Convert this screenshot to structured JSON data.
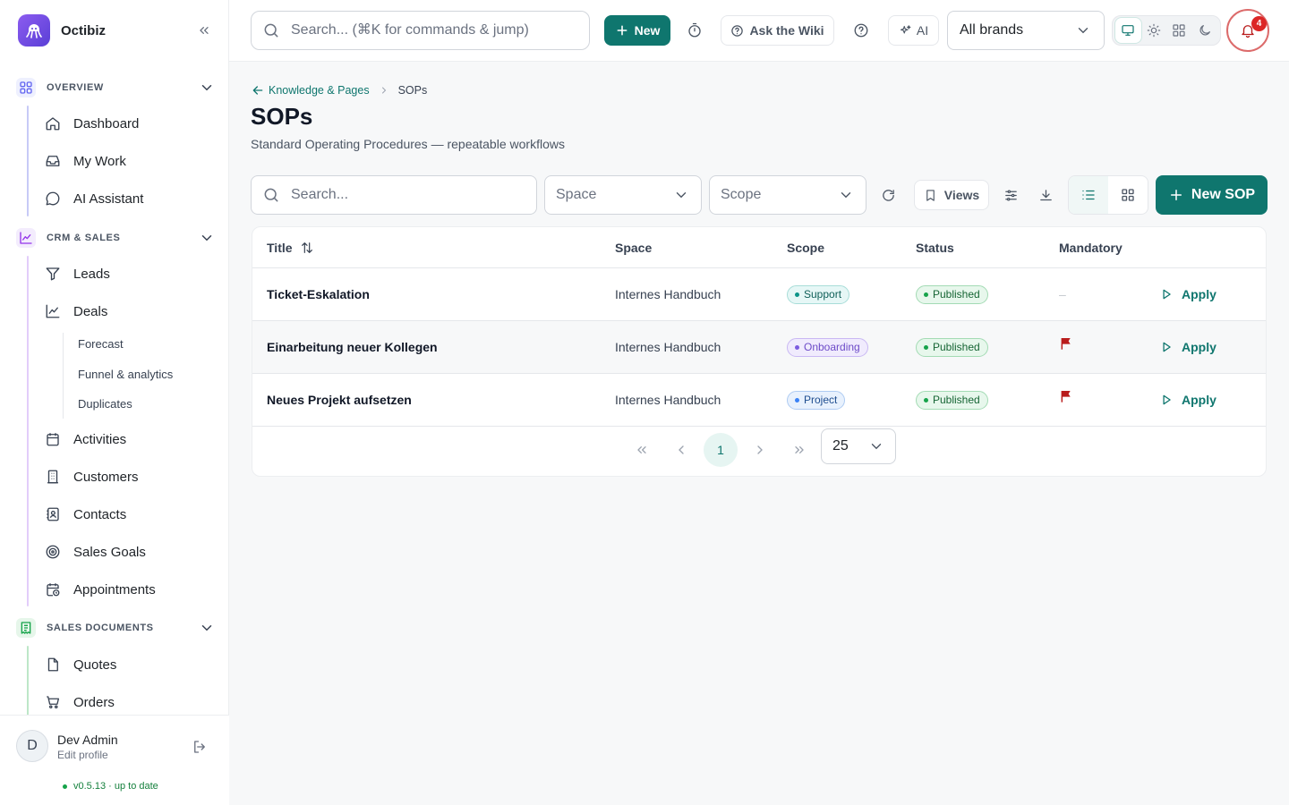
{
  "app": {
    "name": "Octibiz"
  },
  "sidebar": {
    "groups": [
      {
        "title": "OVERVIEW",
        "items": [
          "Dashboard",
          "My Work",
          "AI Assistant"
        ]
      },
      {
        "title": "CRM & SALES",
        "items": [
          "Leads",
          "Deals",
          "Activities",
          "Customers",
          "Contacts",
          "Sales Goals",
          "Appointments"
        ],
        "deals_sub": [
          "Forecast",
          "Funnel & analytics",
          "Duplicates"
        ]
      },
      {
        "title": "SALES DOCUMENTS",
        "items": [
          "Quotes",
          "Orders"
        ]
      }
    ],
    "user": {
      "initial": "D",
      "name": "Dev Admin",
      "edit": "Edit profile"
    },
    "version": "v0.5.13 · up to date"
  },
  "topbar": {
    "search_placeholder": "Search... (⌘K for commands & jump)",
    "new_label": "New",
    "wiki_label": "Ask the Wiki",
    "ai_label": "AI",
    "brand_select": "All brands",
    "notifications_count": "4"
  },
  "page": {
    "breadcrumb": {
      "parent": "Knowledge & Pages",
      "current": "SOPs"
    },
    "title": "SOPs",
    "subtitle": "Standard Operating Procedures — repeatable workflows"
  },
  "toolbar": {
    "search_placeholder": "Search...",
    "space_placeholder": "Space",
    "scope_placeholder": "Scope",
    "views_label": "Views",
    "new_sop_label": "New SOP"
  },
  "table": {
    "columns": [
      "Title",
      "Space",
      "Scope",
      "Status",
      "Mandatory"
    ],
    "rows": [
      {
        "title": "Ticket-Eskalation",
        "space": "Internes Handbuch",
        "scope": "Support",
        "status": "Published",
        "mandatory": "–",
        "action": "Apply"
      },
      {
        "title": "Einarbeitung neuer Kollegen",
        "space": "Internes Handbuch",
        "scope": "Onboarding",
        "status": "Published",
        "mandatory": "flag",
        "action": "Apply"
      },
      {
        "title": "Neues Projekt aufsetzen",
        "space": "Internes Handbuch",
        "scope": "Project",
        "status": "Published",
        "mandatory": "flag",
        "action": "Apply"
      }
    ]
  },
  "pagination": {
    "current_page": "1",
    "per_page": "25"
  },
  "colors": {
    "accent": "#0f766e",
    "flag": "#b91c1c",
    "notification": "#dc2626"
  }
}
